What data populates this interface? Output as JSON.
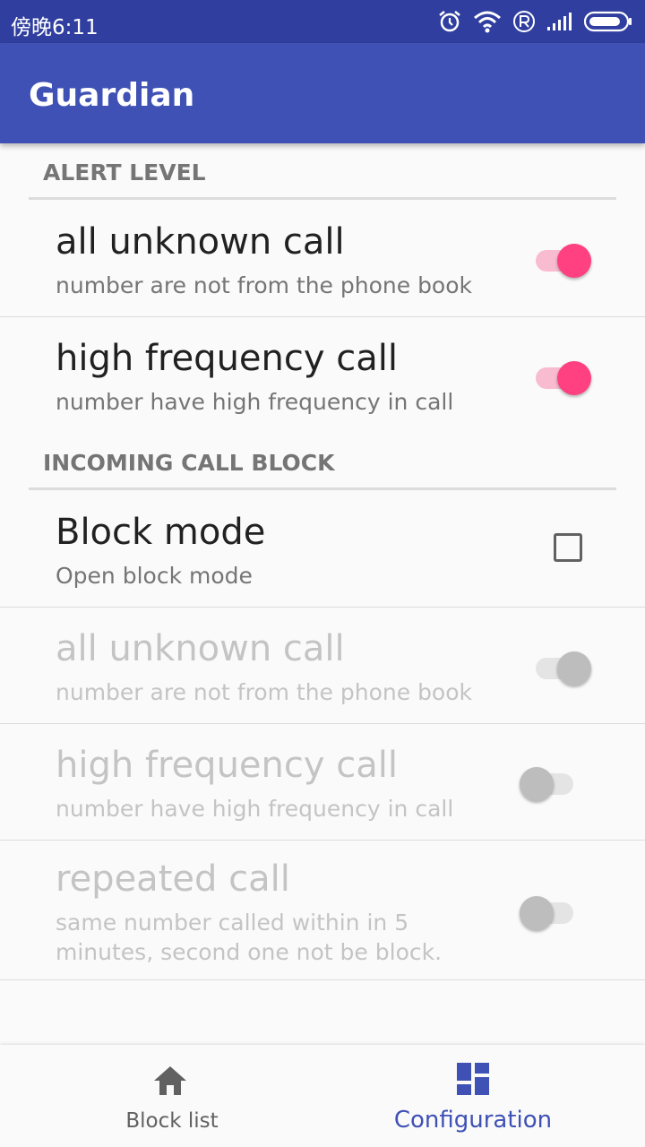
{
  "status_bar": {
    "time": "傍晚6:11"
  },
  "app_bar": {
    "title": "Guardian"
  },
  "sections": {
    "alert_level": {
      "header": "ALERT LEVEL",
      "items": [
        {
          "title": "all unknown call",
          "summary": "number are not from the phone book",
          "state": "on"
        },
        {
          "title": "high frequency call",
          "summary": "number have high frequency in call",
          "state": "on"
        }
      ]
    },
    "incoming_call_block": {
      "header": "INCOMING CALL BLOCK",
      "items": [
        {
          "title": "Block mode",
          "summary": "Open block mode",
          "state": "unchecked"
        },
        {
          "title": "all unknown call",
          "summary": "number are not from the phone book",
          "state": "on (disabled)"
        },
        {
          "title": "high frequency call",
          "summary": "number have high frequency in call",
          "state": "off (disabled)"
        },
        {
          "title": "repeated call",
          "summary": "same number called within in 5 minutes, second one not be block.",
          "state": "off (disabled)"
        }
      ]
    }
  },
  "bottom_nav": {
    "items": [
      {
        "label": "Block list",
        "icon": "home-icon",
        "active": false
      },
      {
        "label": "Configuration",
        "icon": "dashboard-icon",
        "active": true
      }
    ]
  },
  "colors": {
    "status_bar": "#303f9f",
    "primary": "#3f51b5",
    "accent": "#ff4081"
  }
}
